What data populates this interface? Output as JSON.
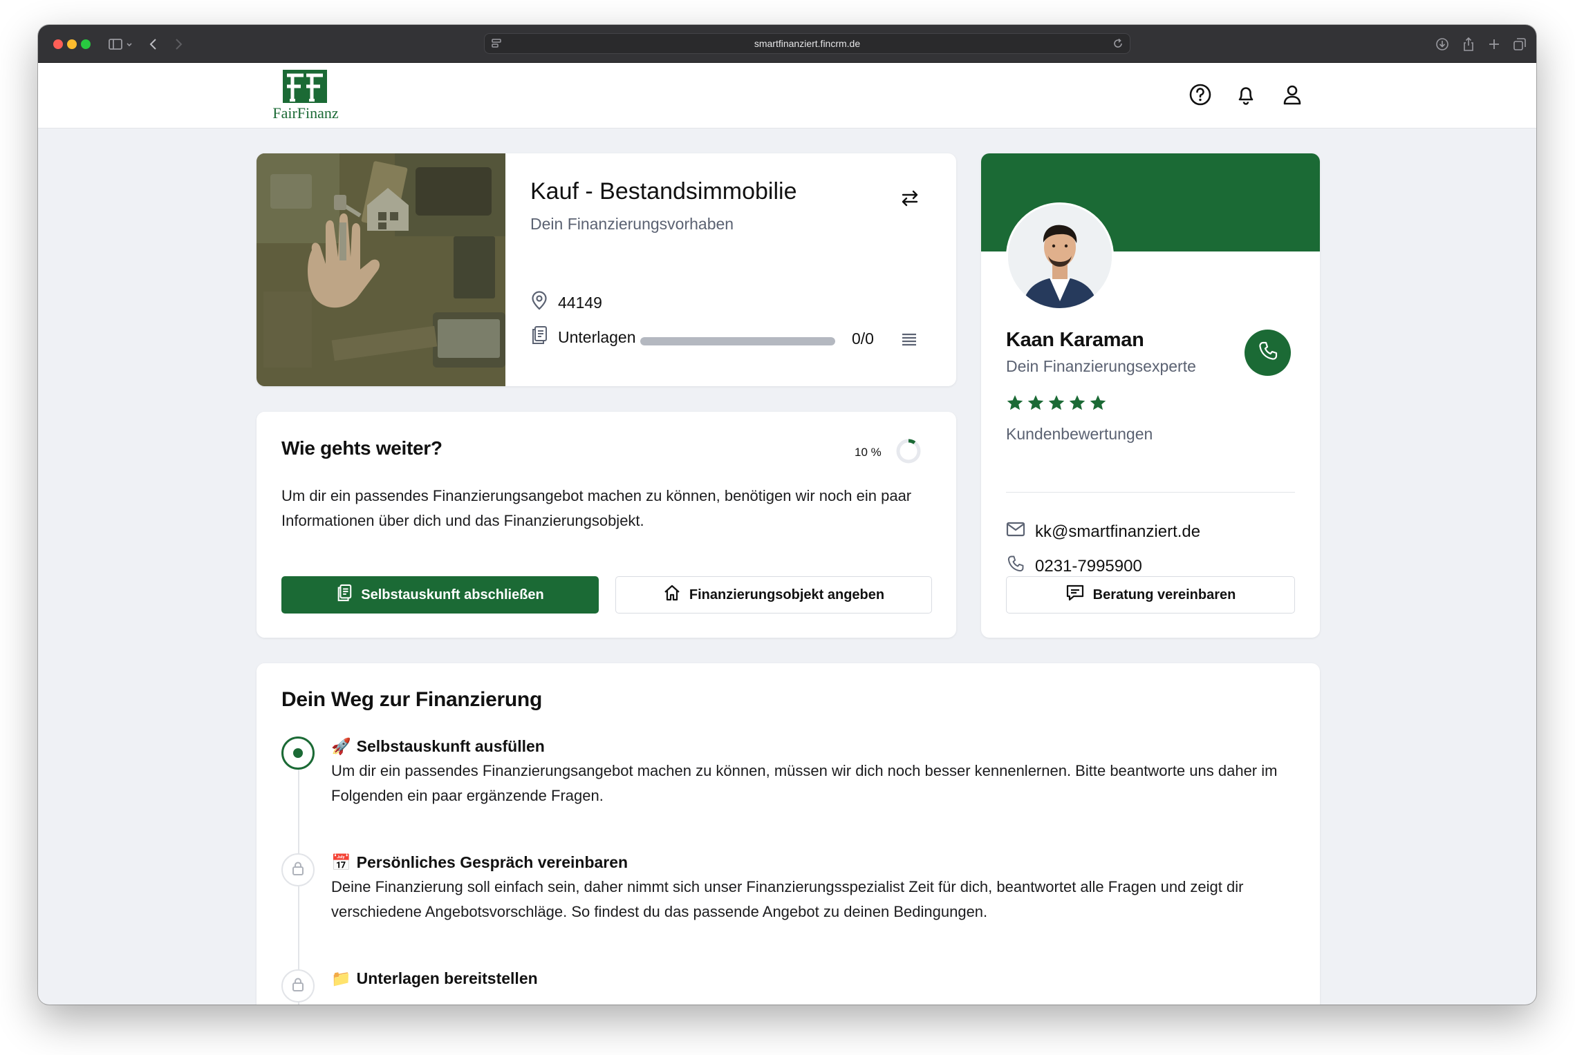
{
  "browser": {
    "url": "smartfinanziert.fincrm.de"
  },
  "header": {
    "logo_text": "FairFinanz",
    "logo_monogram": "FF"
  },
  "project": {
    "title": "Kauf - Bestandsimmobilie",
    "subtitle": "Dein Finanzierungsvorhaben",
    "postal_code": "44149",
    "documents_label": "Unterlagen",
    "documents_count": "0/0",
    "documents_progress": 1.0
  },
  "next_steps": {
    "title": "Wie gehts weiter?",
    "progress_label": "10 %",
    "progress_value": 0.1,
    "text": "Um dir ein passendes Finanzierungsangebot machen zu können, benötigen wir noch ein paar Informationen über dich und das Finanzierungsobjekt.",
    "primary_button": "Selbstauskunft abschließen",
    "secondary_button": "Finanzierungsobjekt angeben"
  },
  "advisor": {
    "name": "Kaan Karaman",
    "role": "Dein Finanzierungsexperte",
    "rating": 5,
    "reviews_label": "Kundenbewertungen",
    "email": "kk@smartfinanziert.de",
    "phone": "0231-7995900",
    "appointment_button": "Beratung vereinbaren"
  },
  "path": {
    "title": "Dein Weg zur Finanzierung",
    "steps": [
      {
        "emoji": "🚀",
        "title": "Selbstauskunft ausfüllen",
        "text": "Um dir ein passendes Finanzierungsangebot machen zu können, müssen wir dich noch besser kennenlernen. Bitte beantworte uns daher im Folgenden ein paar ergänzende Fragen.",
        "state": "active"
      },
      {
        "emoji": "📅",
        "title": "Persönliches Gespräch vereinbaren",
        "text": "Deine Finanzierung soll einfach sein, daher nimmt sich unser Finanzierungsspezialist Zeit für dich, beantwortet alle Fragen und zeigt dir verschiedene Angebotsvorschläge. So findest du das passende Angebot zu deinen Bedingungen.",
        "state": "locked"
      },
      {
        "emoji": "📁",
        "title": "Unterlagen bereitstellen",
        "text": "",
        "state": "locked"
      }
    ]
  },
  "colors": {
    "brand_green": "#1b6a35",
    "page_bg": "#eff1f5",
    "star": "#1b6a35"
  }
}
